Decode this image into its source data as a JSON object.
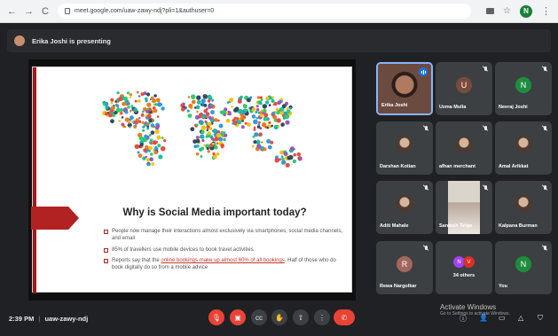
{
  "browser": {
    "url": "meet.google.com/uaw-zawy-ndj?pli=1&authuser=0",
    "profile_initial": "N"
  },
  "presenting_bar": {
    "text": "Erika Joshi is presenting"
  },
  "slide": {
    "title": "Why is Social Media important today?",
    "bullets": [
      {
        "text": "People now manage their interactions almost exclusively via smartphones, social media channels, and email"
      },
      {
        "text": "85% of travellers use mobile devices to book travel activities"
      },
      {
        "pre": "Reports say that the ",
        "link": "online bookings make up almost 60% of all bookings",
        "post": ". Half of those who do book digitally do so from a mobile advice"
      }
    ]
  },
  "participants": [
    {
      "name": "Erika Joshi",
      "type": "video",
      "active": true
    },
    {
      "name": "Uzma Mulla",
      "type": "initial",
      "initial": "U",
      "color": "#7b4b3a"
    },
    {
      "name": "Neeraj Joshi",
      "type": "initial",
      "initial": "N",
      "color": "#1e8e3e"
    },
    {
      "name": "Darshan Kotian",
      "type": "photo"
    },
    {
      "name": "afhan merchant",
      "type": "photo"
    },
    {
      "name": "Amal Arikkat",
      "type": "photo"
    },
    {
      "name": "Aditi Mahale",
      "type": "photo"
    },
    {
      "name": "Santosh Telge",
      "type": "video"
    },
    {
      "name": "Kalpana Burman",
      "type": "photo"
    },
    {
      "name": "Rewa Nargolkar",
      "type": "initial",
      "initial": "R",
      "color": "#a1665e"
    },
    {
      "name": "34 others",
      "type": "others",
      "initials": [
        "N",
        "V"
      ]
    },
    {
      "name": "You",
      "type": "initial",
      "initial": "N",
      "color": "#1e8e3e"
    }
  ],
  "bottom_bar": {
    "time": "2:39 PM",
    "meeting_code": "uaw-zawy-ndj"
  },
  "watermark": {
    "title": "Activate Windows",
    "subtitle": "Go to Settings to activate Windows."
  },
  "colors": {
    "red_control": "#ea4335",
    "active_tile_border": "#8ab4f8",
    "slide_accent": "#b22222"
  }
}
